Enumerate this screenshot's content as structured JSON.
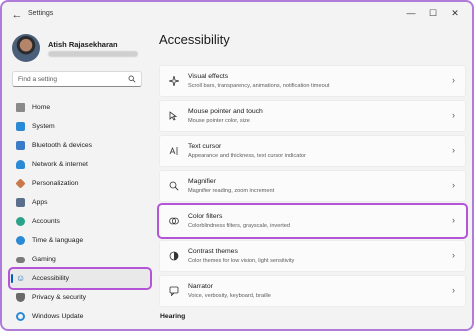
{
  "window": {
    "app_title": "Settings",
    "back_icon": "arrow-left-icon",
    "controls": [
      "—",
      "☐",
      "✕"
    ],
    "accent": "#005fb8",
    "highlight": "#b455d8"
  },
  "profile": {
    "name": "Atish Rajasekharan"
  },
  "search": {
    "placeholder": "Find a setting"
  },
  "sidebar": {
    "items": [
      {
        "label": "Home",
        "icon": "home-icon",
        "color": "#888"
      },
      {
        "label": "System",
        "icon": "monitor-icon",
        "color": "#2b8ad6"
      },
      {
        "label": "Bluetooth & devices",
        "icon": "bluetooth-icon",
        "color": "#2b8ad6"
      },
      {
        "label": "Network & internet",
        "icon": "wifi-icon",
        "color": "#2b8ad6"
      },
      {
        "label": "Personalization",
        "icon": "brush-icon",
        "color": "#c8784a"
      },
      {
        "label": "Apps",
        "icon": "apps-icon",
        "color": "#5a6f8c"
      },
      {
        "label": "Accounts",
        "icon": "person-icon",
        "color": "#2aa38a"
      },
      {
        "label": "Time & language",
        "icon": "globe-clock-icon",
        "color": "#2b8ad6"
      },
      {
        "label": "Gaming",
        "icon": "gamepad-icon",
        "color": "#7a7a7a"
      },
      {
        "label": "Accessibility",
        "icon": "accessibility-icon",
        "color": "#1a6fc4"
      },
      {
        "label": "Privacy & security",
        "icon": "shield-icon",
        "color": "#6a6a6a"
      },
      {
        "label": "Windows Update",
        "icon": "update-icon",
        "color": "#2b8ad6"
      }
    ]
  },
  "main": {
    "title": "Accessibility",
    "cards": [
      {
        "title": "Visual effects",
        "desc": "Scroll bars, transparency, animations, notification timeout",
        "icon": "sparkle-icon"
      },
      {
        "title": "Mouse pointer and touch",
        "desc": "Mouse pointer color, size",
        "icon": "mouse-pointer-icon"
      },
      {
        "title": "Text cursor",
        "desc": "Appearance and thickness, text cursor indicator",
        "icon": "text-cursor-icon"
      },
      {
        "title": "Magnifier",
        "desc": "Magnifier reading, zoom increment",
        "icon": "magnifier-icon"
      },
      {
        "title": "Color filters",
        "desc": "Colorblindness filters, grayscale, inverted",
        "icon": "color-filter-icon"
      },
      {
        "title": "Contrast themes",
        "desc": "Color themes for low vision, light sensitivity",
        "icon": "contrast-icon"
      },
      {
        "title": "Narrator",
        "desc": "Voice, verbosity, keyboard, braille",
        "icon": "narrator-icon"
      }
    ],
    "section": "Hearing"
  }
}
